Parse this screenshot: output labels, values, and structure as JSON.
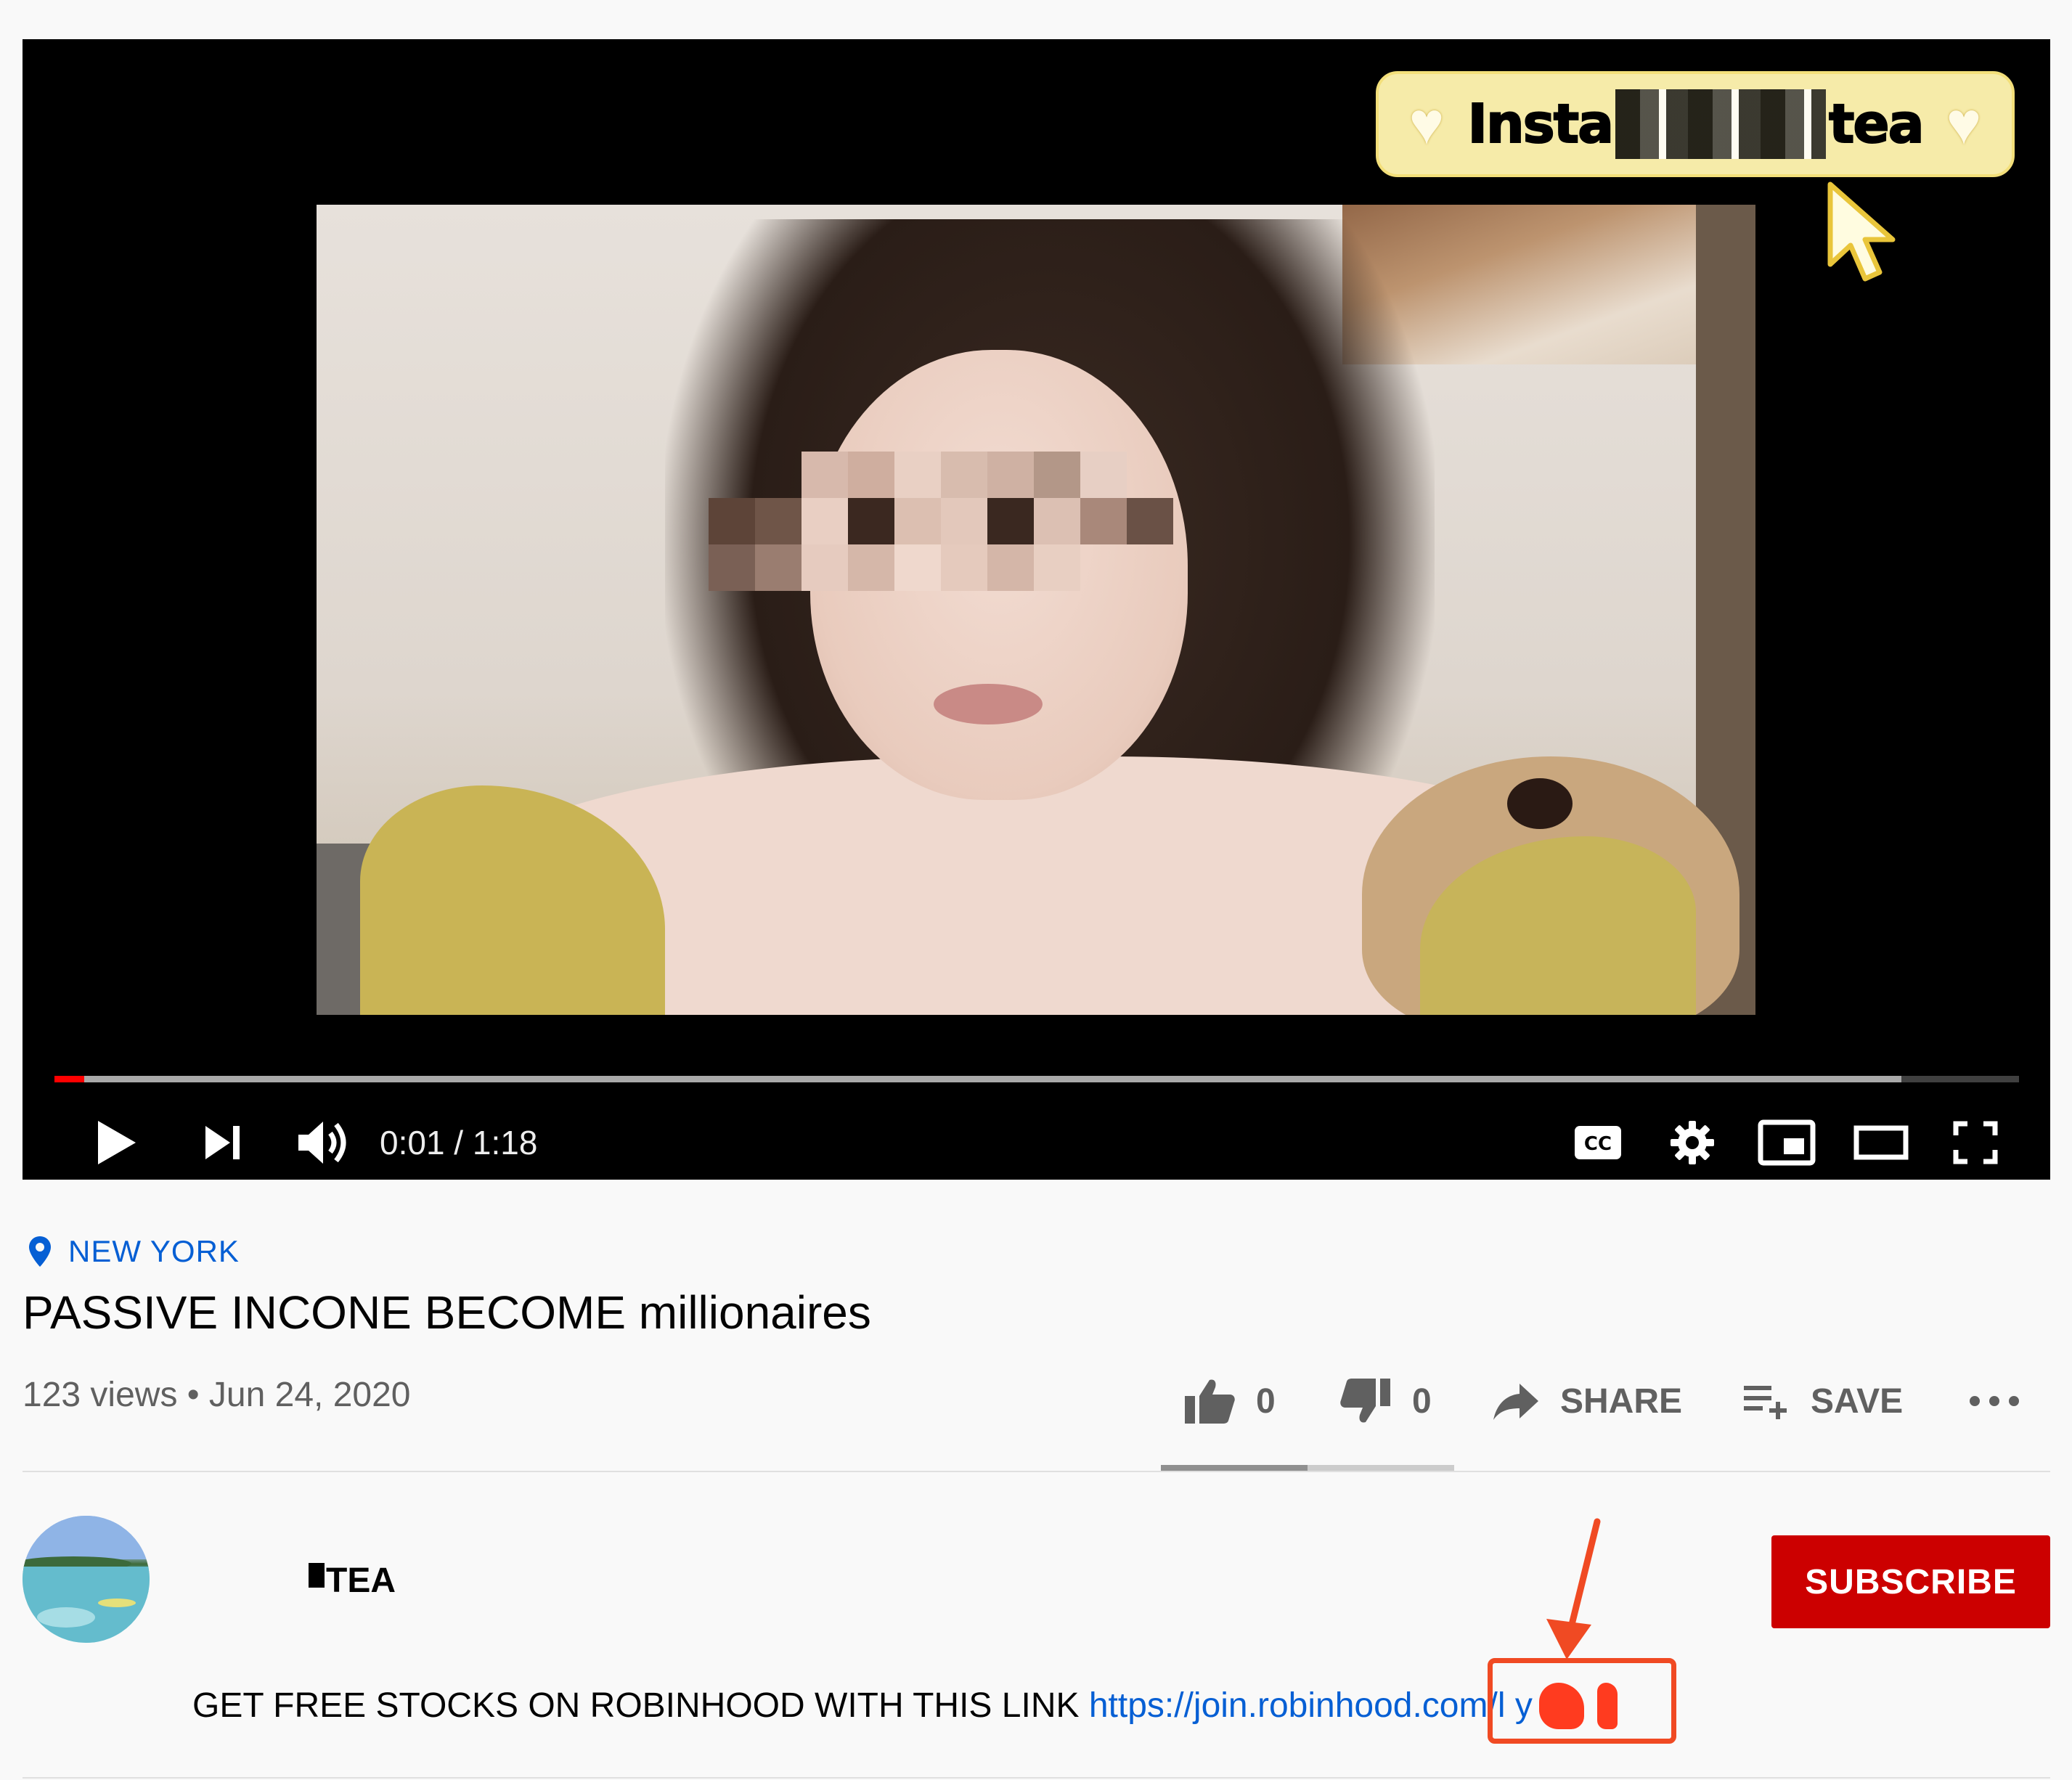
{
  "player": {
    "overlay_banner": {
      "text_left": "Insta",
      "text_right": "tea"
    },
    "progress": {
      "played_fraction": 0.015,
      "buffered_fraction": 0.94
    },
    "time_display": "0:01 / 1:18",
    "controls": {
      "play": "play-icon",
      "next": "next-icon",
      "volume": "volume-icon",
      "captions": "captions-icon",
      "settings": "gear-icon",
      "miniplayer": "miniplayer-icon",
      "theater": "theater-mode-icon",
      "fullscreen": "fullscreen-icon"
    }
  },
  "video_info": {
    "location": "NEW YORK",
    "title": "PASSIVE INCONE BECOME millionaires",
    "meta": "123 views • Jun 24, 2020",
    "likes": "0",
    "dislikes": "0",
    "share_label": "SHARE",
    "save_label": "SAVE",
    "like_fraction": 0.5
  },
  "channel": {
    "name": "TEA",
    "subscribe_label": "SUBSCRIBE"
  },
  "description": {
    "text": "GET FREE STOCKS ON ROBINHOOD WITH THIS LINK ",
    "link_text": "https://join.robinhood.com/l   y  q"
  },
  "colors": {
    "accent_red": "#cc0000",
    "link_blue": "#065fd4",
    "annotation_orange": "#f04a23",
    "progress_red": "#ff0000"
  }
}
